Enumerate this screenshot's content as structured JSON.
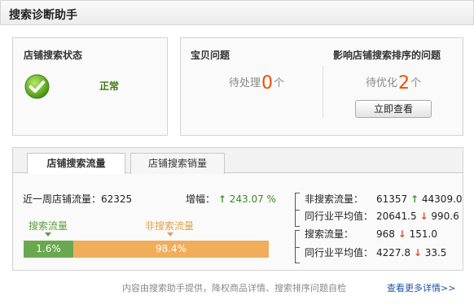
{
  "window": {
    "title": "搜索诊断助手"
  },
  "status": {
    "heading": "店铺搜索状态",
    "value": "正常",
    "icon": "check-circle-icon"
  },
  "item_issues": {
    "heading": "宝贝问题",
    "prefix": "待处理",
    "count": "0",
    "suffix": "个"
  },
  "ranking_issues": {
    "heading": "影响店铺搜索排序的问题",
    "prefix": "待优化",
    "count": "2",
    "suffix": "个",
    "button_label": "立即查看"
  },
  "tabs": [
    {
      "label": "店铺搜索流量",
      "active": true
    },
    {
      "label": "店铺搜索销量",
      "active": false
    }
  ],
  "traffic": {
    "weekly_label": "近一周店铺流量：",
    "weekly_value": "62325",
    "growth_label": "增幅：",
    "growth_value": "243.07 %",
    "legend_search": "搜索流量",
    "legend_nonsearch": "非搜索流量",
    "search_pct_label": "1.6%",
    "nonsearch_pct_label": "98.4%",
    "search_share": 0.016,
    "nonsearch_share": 0.984
  },
  "stats": [
    {
      "label": "非搜索流量：",
      "value": "61357",
      "direction": "up",
      "change": "44309.0"
    },
    {
      "label": "同行业平均值：",
      "value": "20641.5",
      "direction": "down",
      "change": "990.6"
    },
    {
      "label": "搜索流量：",
      "value": "968",
      "direction": "down",
      "change": "151.0"
    },
    {
      "label": "同行业平均值：",
      "value": "4227.8",
      "direction": "down",
      "change": "33.5"
    }
  ],
  "footer": {
    "note": "内容由搜索助手提供，降权商品详情、搜索排序问题自检",
    "link": "查看更多详情>>"
  },
  "colors": {
    "accent_red": "#f04e00",
    "search_green": "#6aa84f",
    "nonsearch_orange": "#f0ad5a",
    "link_blue": "#1a55a8"
  }
}
